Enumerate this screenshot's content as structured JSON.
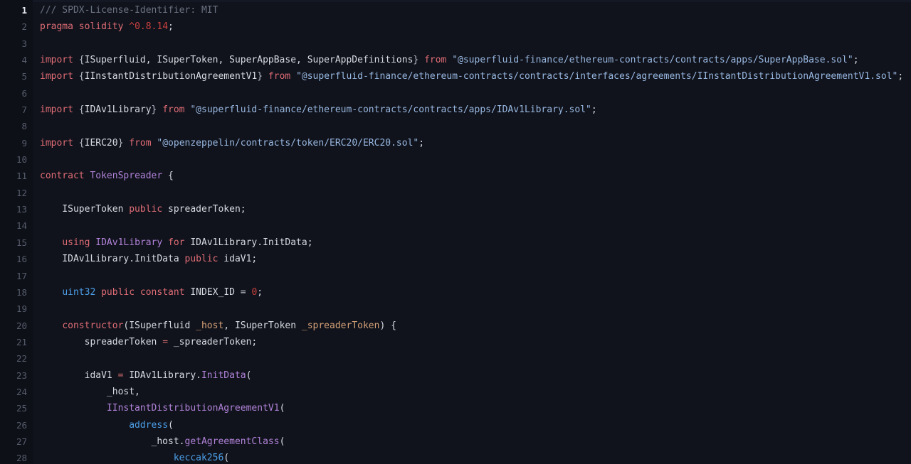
{
  "editor": {
    "language": "solidity",
    "background": "#10131c",
    "gutter_background": "#0d1017",
    "active_line": 1,
    "first_visible_line": 1,
    "last_visible_line": 28,
    "colors": {
      "comment": "#6b7280",
      "keyword": "#e06c75",
      "number": "#c9413f",
      "string": "#98b7e0",
      "type": "#b182d8",
      "builtin": "#4d9fe8",
      "function": "#b182d8",
      "parameter": "#d6a178",
      "plain": "#d7dae0",
      "line_number": "#565c6b",
      "line_number_active": "#e8eaef"
    }
  },
  "lines": [
    {
      "n": "1",
      "tokens": [
        {
          "t": "/// SPDX-License-Identifier: MIT",
          "c": "cm"
        }
      ]
    },
    {
      "n": "2",
      "tokens": [
        {
          "t": "pragma",
          "c": "kw"
        },
        {
          "t": " ",
          "c": "pl"
        },
        {
          "t": "solidity",
          "c": "kw"
        },
        {
          "t": " ",
          "c": "pl"
        },
        {
          "t": "^0.8.14",
          "c": "num"
        },
        {
          "t": ";",
          "c": "pl"
        }
      ]
    },
    {
      "n": "3",
      "tokens": []
    },
    {
      "n": "4",
      "tokens": [
        {
          "t": "import",
          "c": "kw"
        },
        {
          "t": " ",
          "c": "pl"
        },
        {
          "t": "{",
          "c": "pun"
        },
        {
          "t": "ISuperfluid, ISuperToken, SuperAppBase, SuperAppDefinitions",
          "c": "pl"
        },
        {
          "t": "}",
          "c": "pun"
        },
        {
          "t": " ",
          "c": "pl"
        },
        {
          "t": "from",
          "c": "kw"
        },
        {
          "t": " ",
          "c": "pl"
        },
        {
          "t": "\"@superfluid-finance/ethereum-contracts/contracts/apps/SuperAppBase.sol\"",
          "c": "str"
        },
        {
          "t": ";",
          "c": "pl"
        }
      ]
    },
    {
      "n": "5",
      "tokens": [
        {
          "t": "import",
          "c": "kw"
        },
        {
          "t": " ",
          "c": "pl"
        },
        {
          "t": "{",
          "c": "pun"
        },
        {
          "t": "IInstantDistributionAgreementV1",
          "c": "pl"
        },
        {
          "t": "}",
          "c": "pun"
        },
        {
          "t": " ",
          "c": "pl"
        },
        {
          "t": "from",
          "c": "kw"
        },
        {
          "t": " ",
          "c": "pl"
        },
        {
          "t": "\"@superfluid-finance/ethereum-contracts/contracts/interfaces/agreements/IInstantDistributionAgreementV1.sol\"",
          "c": "str"
        },
        {
          "t": ";",
          "c": "pl"
        }
      ]
    },
    {
      "n": "6",
      "tokens": []
    },
    {
      "n": "7",
      "tokens": [
        {
          "t": "import",
          "c": "kw"
        },
        {
          "t": " ",
          "c": "pl"
        },
        {
          "t": "{",
          "c": "pun"
        },
        {
          "t": "IDAv1Library",
          "c": "pl"
        },
        {
          "t": "}",
          "c": "pun"
        },
        {
          "t": " ",
          "c": "pl"
        },
        {
          "t": "from",
          "c": "kw"
        },
        {
          "t": " ",
          "c": "pl"
        },
        {
          "t": "\"@superfluid-finance/ethereum-contracts/contracts/apps/IDAv1Library.sol\"",
          "c": "str"
        },
        {
          "t": ";",
          "c": "pl"
        }
      ]
    },
    {
      "n": "8",
      "tokens": []
    },
    {
      "n": "9",
      "tokens": [
        {
          "t": "import",
          "c": "kw"
        },
        {
          "t": " ",
          "c": "pl"
        },
        {
          "t": "{",
          "c": "pun"
        },
        {
          "t": "IERC20",
          "c": "pl"
        },
        {
          "t": "}",
          "c": "pun"
        },
        {
          "t": " ",
          "c": "pl"
        },
        {
          "t": "from",
          "c": "kw"
        },
        {
          "t": " ",
          "c": "pl"
        },
        {
          "t": "\"@openzeppelin/contracts/token/ERC20/ERC20.sol\"",
          "c": "str"
        },
        {
          "t": ";",
          "c": "pl"
        }
      ]
    },
    {
      "n": "10",
      "tokens": []
    },
    {
      "n": "11",
      "tokens": [
        {
          "t": "contract",
          "c": "kw"
        },
        {
          "t": " ",
          "c": "pl"
        },
        {
          "t": "TokenSpreader",
          "c": "typ"
        },
        {
          "t": " {",
          "c": "pl"
        }
      ]
    },
    {
      "n": "12",
      "tokens": []
    },
    {
      "n": "13",
      "tokens": [
        {
          "t": "    ISuperToken ",
          "c": "pl"
        },
        {
          "t": "public",
          "c": "kw"
        },
        {
          "t": " spreaderToken;",
          "c": "pl"
        }
      ]
    },
    {
      "n": "14",
      "tokens": []
    },
    {
      "n": "15",
      "tokens": [
        {
          "t": "    ",
          "c": "pl"
        },
        {
          "t": "using",
          "c": "kw"
        },
        {
          "t": " ",
          "c": "pl"
        },
        {
          "t": "IDAv1Library",
          "c": "typ"
        },
        {
          "t": " ",
          "c": "pl"
        },
        {
          "t": "for",
          "c": "kw"
        },
        {
          "t": " IDAv1Library.InitData;",
          "c": "pl"
        }
      ]
    },
    {
      "n": "16",
      "tokens": [
        {
          "t": "    IDAv1Library.InitData ",
          "c": "pl"
        },
        {
          "t": "public",
          "c": "kw"
        },
        {
          "t": " idaV1;",
          "c": "pl"
        }
      ]
    },
    {
      "n": "17",
      "tokens": []
    },
    {
      "n": "18",
      "tokens": [
        {
          "t": "    ",
          "c": "pl"
        },
        {
          "t": "uint32",
          "c": "bi"
        },
        {
          "t": " ",
          "c": "pl"
        },
        {
          "t": "public",
          "c": "kw"
        },
        {
          "t": " ",
          "c": "pl"
        },
        {
          "t": "constant",
          "c": "kw"
        },
        {
          "t": " INDEX_ID = ",
          "c": "pl"
        },
        {
          "t": "0",
          "c": "num"
        },
        {
          "t": ";",
          "c": "pl"
        }
      ]
    },
    {
      "n": "19",
      "tokens": []
    },
    {
      "n": "20",
      "tokens": [
        {
          "t": "    ",
          "c": "pl"
        },
        {
          "t": "constructor",
          "c": "kw"
        },
        {
          "t": "(ISuperfluid ",
          "c": "pl"
        },
        {
          "t": "_host",
          "c": "par"
        },
        {
          "t": ", ISuperToken ",
          "c": "pl"
        },
        {
          "t": "_spreaderToken",
          "c": "par"
        },
        {
          "t": ") {",
          "c": "pl"
        }
      ]
    },
    {
      "n": "21",
      "tokens": [
        {
          "t": "        spreaderToken ",
          "c": "pl"
        },
        {
          "t": "=",
          "c": "op"
        },
        {
          "t": " _spreaderToken;",
          "c": "pl"
        }
      ]
    },
    {
      "n": "22",
      "tokens": []
    },
    {
      "n": "23",
      "tokens": [
        {
          "t": "        idaV1 ",
          "c": "pl"
        },
        {
          "t": "=",
          "c": "op"
        },
        {
          "t": " IDAv1Library.",
          "c": "pl"
        },
        {
          "t": "InitData",
          "c": "fn"
        },
        {
          "t": "(",
          "c": "pl"
        }
      ]
    },
    {
      "n": "24",
      "tokens": [
        {
          "t": "            _host,",
          "c": "pl"
        }
      ]
    },
    {
      "n": "25",
      "tokens": [
        {
          "t": "            ",
          "c": "pl"
        },
        {
          "t": "IInstantDistributionAgreementV1",
          "c": "fn"
        },
        {
          "t": "(",
          "c": "pl"
        }
      ]
    },
    {
      "n": "26",
      "tokens": [
        {
          "t": "                ",
          "c": "pl"
        },
        {
          "t": "address",
          "c": "bi"
        },
        {
          "t": "(",
          "c": "pl"
        }
      ]
    },
    {
      "n": "27",
      "tokens": [
        {
          "t": "                    _host.",
          "c": "pl"
        },
        {
          "t": "getAgreementClass",
          "c": "fn"
        },
        {
          "t": "(",
          "c": "pl"
        }
      ]
    },
    {
      "n": "28",
      "tokens": [
        {
          "t": "                        ",
          "c": "pl"
        },
        {
          "t": "keccak256",
          "c": "bi"
        },
        {
          "t": "(",
          "c": "pl"
        }
      ]
    }
  ]
}
